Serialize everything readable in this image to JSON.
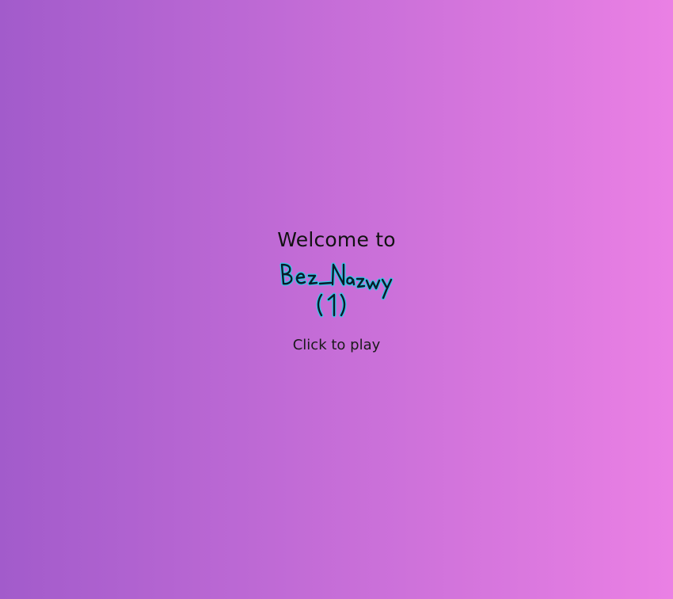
{
  "screen": {
    "welcome_text": "Welcome to",
    "logo_text": "Bez_Nazwy (1)",
    "prompt_text": "Click to play",
    "background_gradient": [
      "#a25bcb",
      "#ea80e4"
    ],
    "logo_stroke_color": "#0a1a2a",
    "logo_glow_color": "#34c6e6"
  }
}
